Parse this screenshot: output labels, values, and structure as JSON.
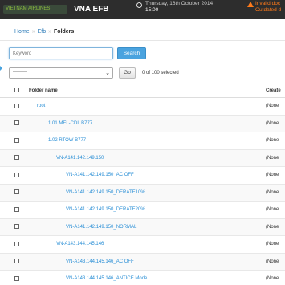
{
  "header": {
    "logo_text": "VIETNAM AIRLINES",
    "app_title": "VNA EFB",
    "date_line": "Thursday, 16th October 2014",
    "time_line": "15:00",
    "warning_line1": "Invalid doc",
    "warning_line2": "Outdated d"
  },
  "breadcrumb": {
    "home": "Home",
    "efb": "Efb",
    "current": "Folders"
  },
  "search": {
    "placeholder": "Keyword",
    "button_label": "Search"
  },
  "actions": {
    "select_value": "---------",
    "go_label": "Go",
    "selected_text": "0 of 100 selected"
  },
  "table": {
    "columns": {
      "name": "Folder name",
      "created": "Create"
    },
    "rows": [
      {
        "name": "root",
        "created": "(None"
      },
      {
        "name": "1.01 MEL-CDL B777",
        "created": "(None"
      },
      {
        "name": "1.02 RTOW B777",
        "created": "(None"
      },
      {
        "name": "VN-A141.142.149.150",
        "created": "(None"
      },
      {
        "name": "VN-A141.142.149.150_AC OFF",
        "created": "(None"
      },
      {
        "name": "VN-A141.142.149.150_DERATE10%",
        "created": "(None"
      },
      {
        "name": "VN-A141.142.149.150_DERATE20%",
        "created": "(None"
      },
      {
        "name": "VN-A141.142.149.150_NORMAL",
        "created": "(None"
      },
      {
        "name": "VN-A143.144.145.146",
        "created": "(None"
      },
      {
        "name": "VN-A143.144.145.146_AC OFF",
        "created": "(None"
      },
      {
        "name": "VN-A143.144.145.146_ANTICE Mode",
        "created": "(None"
      }
    ]
  },
  "colors": {
    "topbar": "#2d2d2d",
    "link": "#2a8fd6",
    "search_button": "#4aa3df",
    "warning": "#ff7a1a"
  }
}
